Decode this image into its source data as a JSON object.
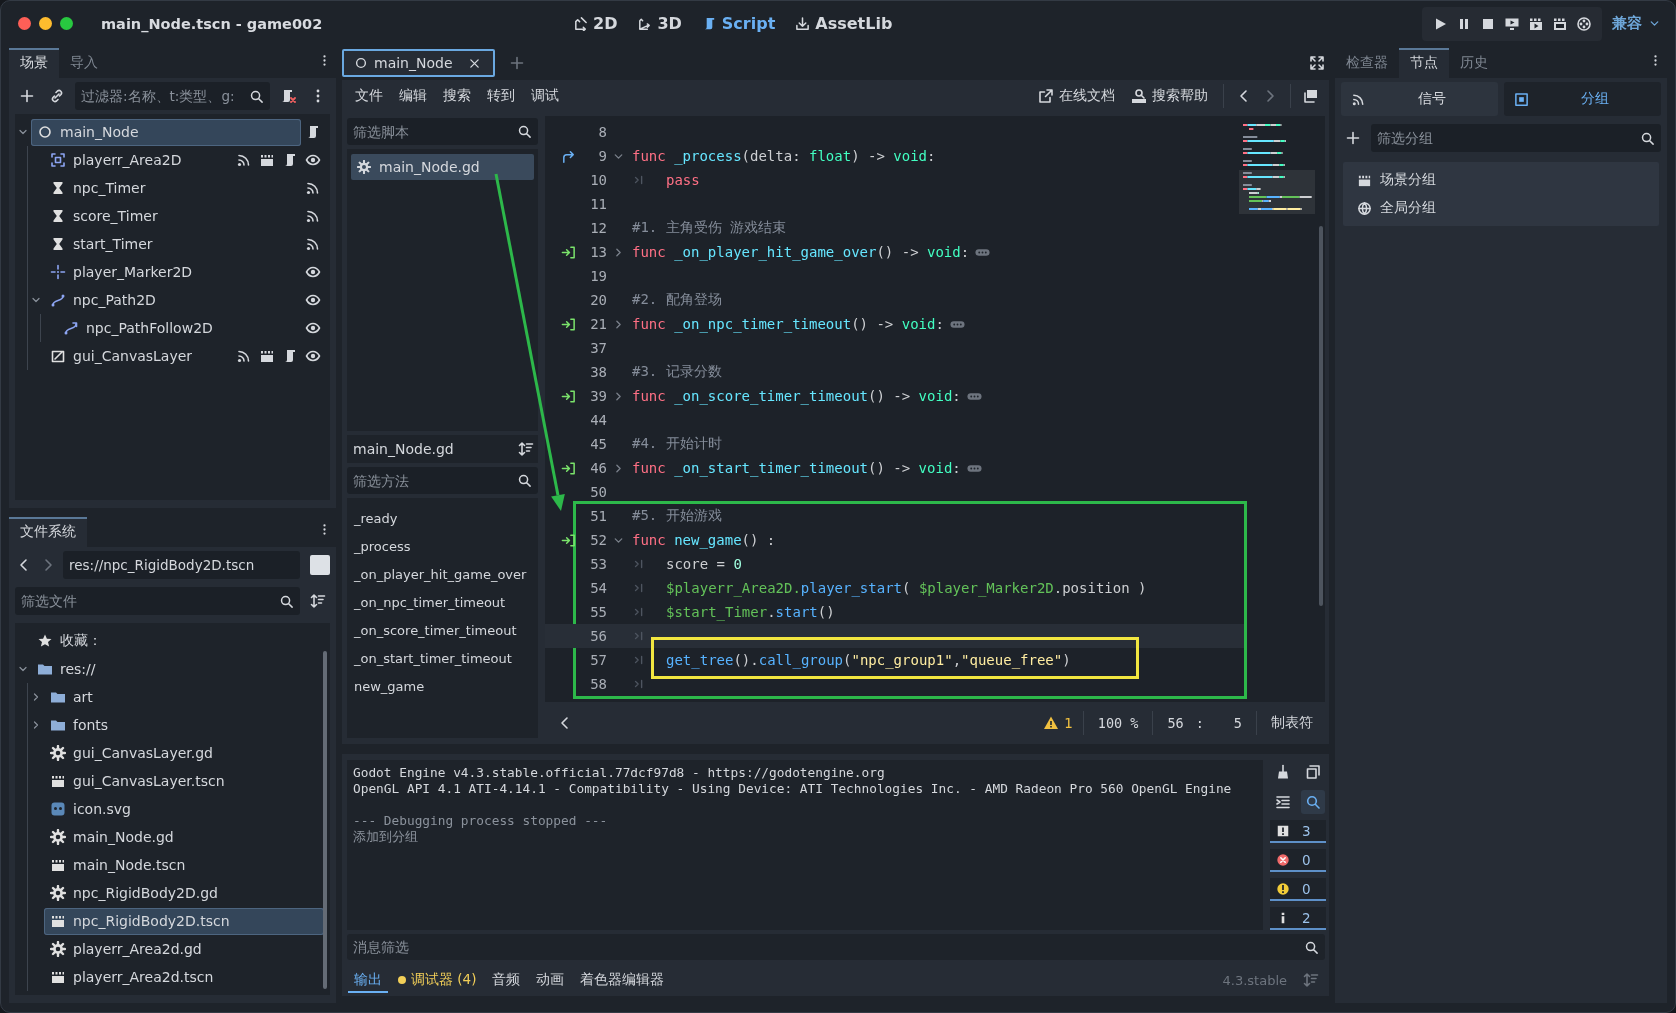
{
  "window": {
    "title": "main_Node.tscn - game002"
  },
  "main_screens": [
    {
      "label": "2D",
      "selected": false
    },
    {
      "label": "3D",
      "selected": false
    },
    {
      "label": "Script",
      "selected": true
    },
    {
      "label": "AssetLib",
      "selected": false
    }
  ],
  "run_bar": {
    "renderer": "兼容"
  },
  "scene_dock": {
    "tabs": [
      {
        "label": "场景",
        "selected": true
      },
      {
        "label": "导入",
        "selected": false
      }
    ],
    "filter": {
      "placeholder": "过滤器:名称、t:类型、g:"
    },
    "tree": [
      {
        "name": "main_Node",
        "kind": "node",
        "selected": true,
        "expanded": true,
        "badges": [
          {
            "kind": "script"
          }
        ],
        "children": [
          {
            "name": "playerr_Area2D",
            "kind": "area",
            "selected": false,
            "badges": [
              {
                "kind": "signals"
              },
              {
                "kind": "groups"
              },
              {
                "kind": "script"
              },
              {
                "kind": "visible"
              }
            ]
          },
          {
            "name": "npc_Timer",
            "kind": "timer",
            "selected": false,
            "badges": [
              {
                "kind": "signals"
              }
            ]
          },
          {
            "name": "score_Timer",
            "kind": "timer",
            "selected": false,
            "badges": [
              {
                "kind": "signals"
              }
            ]
          },
          {
            "name": "start_Timer",
            "kind": "timer",
            "selected": false,
            "badges": [
              {
                "kind": "signals"
              }
            ]
          },
          {
            "name": "player_Marker2D",
            "kind": "marker",
            "selected": false,
            "badges": [
              {
                "kind": "visible"
              }
            ]
          },
          {
            "name": "npc_Path2D",
            "kind": "path",
            "selected": false,
            "expanded": true,
            "badges": [
              {
                "kind": "visible"
              }
            ],
            "children": [
              {
                "name": "npc_PathFollow2D",
                "kind": "follow",
                "selected": false,
                "badges": [
                  {
                    "kind": "visible"
                  }
                ]
              }
            ]
          },
          {
            "name": "gui_CanvasLayer",
            "kind": "layer",
            "selected": false,
            "badges": [
              {
                "kind": "signals"
              },
              {
                "kind": "groups"
              },
              {
                "kind": "script"
              },
              {
                "kind": "visible"
              }
            ]
          }
        ]
      }
    ]
  },
  "filesystem": {
    "tabs": [
      {
        "label": "文件系统",
        "selected": true
      }
    ],
    "path": "res://npc_RigidBody2D.tscn",
    "filter": {
      "placeholder": "筛选文件"
    },
    "favorites": "收藏：",
    "tree": [
      {
        "name": "res://",
        "kind": "folder",
        "selected": false,
        "expanded": true,
        "children": [
          {
            "name": "art",
            "kind": "folder",
            "selected": false,
            "expanded": false
          },
          {
            "name": "fonts",
            "kind": "folder",
            "selected": false,
            "expanded": false
          },
          {
            "name": "gui_CanvasLayer.gd",
            "kind": "script",
            "selected": false
          },
          {
            "name": "gui_CanvasLayer.tscn",
            "kind": "scene",
            "selected": false
          },
          {
            "name": "icon.svg",
            "kind": "image",
            "selected": false
          },
          {
            "name": "main_Node.gd",
            "kind": "script",
            "selected": false
          },
          {
            "name": "main_Node.tscn",
            "kind": "scene",
            "selected": false
          },
          {
            "name": "npc_RigidBody2D.gd",
            "kind": "script",
            "selected": false
          },
          {
            "name": "npc_RigidBody2D.tscn",
            "kind": "scene",
            "selected": true
          },
          {
            "name": "playerr_Area2d.gd",
            "kind": "script",
            "selected": false
          },
          {
            "name": "playerr_Area2d.tscn",
            "kind": "scene",
            "selected": false
          }
        ]
      }
    ]
  },
  "script_tabs": [
    {
      "label": "main_Node",
      "selected": true
    }
  ],
  "script_menu": [
    "文件",
    "编辑",
    "搜索",
    "转到",
    "调试"
  ],
  "help_links": [
    "在线文档",
    "搜索帮助"
  ],
  "script_panel": {
    "filter": {
      "placeholder": "筛选脚本"
    },
    "scripts": [
      {
        "name": "main_Node.gd",
        "selected": true
      }
    ],
    "current": "main_Node.gd",
    "method_filter": {
      "placeholder": "筛选方法"
    },
    "methods": [
      "_ready",
      "_process",
      "_on_player_hit_game_over",
      "_on_npc_timer_timeout",
      "_on_score_timer_timeout",
      "_on_start_timer_timeout",
      "new_game"
    ]
  },
  "code": {
    "blocks": [
      {
        "lines": [
          {
            "number": "8"
          },
          {
            "number": "9",
            "marker": {
              "kind": "override"
            },
            "expanded": true,
            "tokens": [
              {
                "kind": "keyword",
                "text": "func"
              },
              {
                "kind": "function",
                "text": "_process"
              },
              {
                "kind": "text",
                "text": "(delta: "
              },
              {
                "kind": "type",
                "text": "float"
              },
              {
                "kind": "text",
                "text": ") -> "
              },
              {
                "kind": "type",
                "text": "void"
              },
              {
                "kind": "text",
                "text": ":"
              }
            ]
          },
          {
            "number": "10",
            "tab": true,
            "tokens": [
              {
                "kind": "keyword",
                "text": "pass"
              }
            ]
          },
          {
            "number": "11"
          },
          {
            "number": "12",
            "tokens": [
              {
                "kind": "comment",
                "text": "#1. 主角受伤 游戏结束"
              }
            ]
          },
          {
            "number": "13",
            "marker": {
              "kind": "signal"
            },
            "expanded": false,
            "folded": true,
            "tokens": [
              {
                "kind": "keyword",
                "text": "func"
              },
              {
                "kind": "function",
                "text": "_on_player_hit_game_over"
              },
              {
                "kind": "text",
                "text": "() -> "
              },
              {
                "kind": "type",
                "text": "void"
              },
              {
                "kind": "text",
                "text": ":"
              }
            ]
          },
          {
            "number": "19"
          },
          {
            "number": "20",
            "tokens": [
              {
                "kind": "comment",
                "text": "#2. 配角登场"
              }
            ]
          },
          {
            "number": "21",
            "marker": {
              "kind": "signal"
            },
            "expanded": false,
            "folded": true,
            "tokens": [
              {
                "kind": "keyword",
                "text": "func"
              },
              {
                "kind": "function",
                "text": "_on_npc_timer_timeout"
              },
              {
                "kind": "text",
                "text": "() -> "
              },
              {
                "kind": "type",
                "text": "void"
              },
              {
                "kind": "text",
                "text": ":"
              }
            ]
          },
          {
            "number": "37"
          },
          {
            "number": "38",
            "tokens": [
              {
                "kind": "comment",
                "text": "#3. 记录分数"
              }
            ]
          },
          {
            "number": "39",
            "marker": {
              "kind": "signal"
            },
            "expanded": false,
            "folded": true,
            "tokens": [
              {
                "kind": "keyword",
                "text": "func"
              },
              {
                "kind": "function",
                "text": "_on_score_timer_timeout"
              },
              {
                "kind": "text",
                "text": "() -> "
              },
              {
                "kind": "type",
                "text": "void"
              },
              {
                "kind": "text",
                "text": ":"
              }
            ]
          },
          {
            "number": "44"
          },
          {
            "number": "45",
            "tokens": [
              {
                "kind": "comment",
                "text": "#4. 开始计时"
              }
            ]
          },
          {
            "number": "46",
            "marker": {
              "kind": "signal"
            },
            "expanded": false,
            "folded": true,
            "tokens": [
              {
                "kind": "keyword",
                "text": "func"
              },
              {
                "kind": "function",
                "text": "_on_start_timer_timeout"
              },
              {
                "kind": "text",
                "text": "() -> "
              },
              {
                "kind": "type",
                "text": "void"
              },
              {
                "kind": "text",
                "text": ":"
              }
            ]
          },
          {
            "number": "50"
          }
        ]
      },
      {
        "frame": {
          "color": "#2db84a",
          "arrow": true
        },
        "lines": [
          {
            "number": "51",
            "tokens": [
              {
                "kind": "comment",
                "text": "#5. 开始游戏"
              }
            ]
          },
          {
            "number": "52",
            "marker": {
              "kind": "signal"
            },
            "expanded": true,
            "tokens": [
              {
                "kind": "keyword",
                "text": "func"
              },
              {
                "kind": "function",
                "text": "new_game"
              },
              {
                "kind": "text",
                "text": "() :"
              }
            ]
          },
          {
            "number": "53",
            "tab": true,
            "tokens": [
              {
                "kind": "text",
                "text": "score = "
              },
              {
                "kind": "number",
                "text": "0"
              }
            ]
          },
          {
            "number": "54",
            "tab": true,
            "tokens": [
              {
                "kind": "node",
                "text": "$playerr_Area2D."
              },
              {
                "kind": "member",
                "text": "player_start"
              },
              {
                "kind": "text",
                "text": "( "
              },
              {
                "kind": "node",
                "text": "$player_Marker2D"
              },
              {
                "kind": "text",
                "text": ".position )"
              }
            ]
          },
          {
            "number": "55",
            "tab": true,
            "tokens": [
              {
                "kind": "node",
                "text": "$start_Timer"
              },
              {
                "kind": "text",
                "text": "."
              },
              {
                "kind": "member",
                "text": "start"
              },
              {
                "kind": "text",
                "text": "()"
              }
            ]
          },
          {
            "number": "56",
            "tab": true,
            "current": true
          },
          {
            "number": "57",
            "tab": true,
            "frame": {
              "color": "#f2e640"
            },
            "tokens": [
              {
                "kind": "member",
                "text": "get_tree"
              },
              {
                "kind": "text",
                "text": "()."
              },
              {
                "kind": "member",
                "text": "call_group"
              },
              {
                "kind": "text",
                "text": "("
              },
              {
                "kind": "string",
                "text": "\"npc_group1\""
              },
              {
                "kind": "text",
                "text": ","
              },
              {
                "kind": "string",
                "text": "\"queue_free\""
              },
              {
                "kind": "text",
                "text": ")"
              }
            ]
          },
          {
            "number": "58",
            "tab": true
          }
        ]
      }
    ]
  },
  "status_bar": {
    "warnings": "1",
    "zoom": "100 %",
    "line": "56",
    "separator": ":",
    "column": "5",
    "indent": "制表符"
  },
  "output": {
    "lines": [
      {
        "kind": "normal",
        "text": "Godot Engine v4.3.stable.official.77dcf97d8 - https://godotengine.org"
      },
      {
        "kind": "normal",
        "text": "OpenGL API 4.1 ATI-4.14.1 - Compatibility - Using Device: ATI Technologies Inc. - AMD Radeon Pro 560 OpenGL Engine"
      },
      {
        "kind": "dim",
        "spaced": true,
        "text": "--- Debugging process stopped ---"
      },
      {
        "kind": "dim",
        "text": "添加到分组"
      }
    ],
    "filter": {
      "placeholder": "消息筛选"
    },
    "counters": [
      {
        "kind": "message",
        "count": "3"
      },
      {
        "kind": "error",
        "count": "0"
      },
      {
        "kind": "warning",
        "count": "0"
      },
      {
        "kind": "info",
        "count": "2"
      }
    ]
  },
  "bottom_tabs": [
    {
      "label": "输出",
      "selected": true,
      "alert": false
    },
    {
      "label": "调试器 (4)",
      "selected": false,
      "alert": true
    },
    {
      "label": "音频",
      "selected": false,
      "alert": false
    },
    {
      "label": "动画",
      "selected": false,
      "alert": false
    },
    {
      "label": "着色器编辑器",
      "selected": false,
      "alert": false
    }
  ],
  "version": "4.3.stable",
  "right_dock": {
    "tabs": [
      {
        "label": "检查器",
        "selected": false
      },
      {
        "label": "节点",
        "selected": true
      },
      {
        "label": "历史",
        "selected": false
      }
    ],
    "subtabs": [
      {
        "label": "信号",
        "selected": false
      },
      {
        "label": "分组",
        "selected": true
      }
    ],
    "filter": {
      "placeholder": "筛选分组"
    },
    "groups": [
      "场景分组",
      "全局分组"
    ]
  }
}
